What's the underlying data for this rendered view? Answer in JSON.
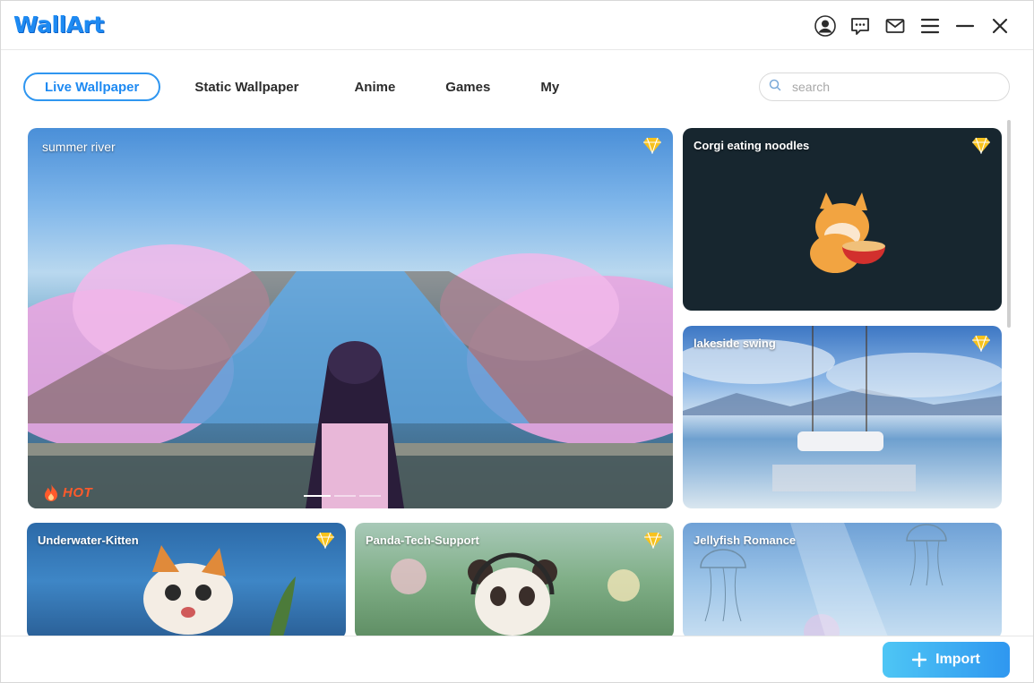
{
  "app": {
    "logo": "WallArt"
  },
  "titlebar": {
    "icons": [
      "user-icon",
      "feedback-icon",
      "mail-icon",
      "menu-icon",
      "minimize-icon",
      "close-icon"
    ]
  },
  "tabs": [
    {
      "label": "Live Wallpaper",
      "active": true
    },
    {
      "label": "Static Wallpaper",
      "active": false
    },
    {
      "label": "Anime",
      "active": false
    },
    {
      "label": "Games",
      "active": false
    },
    {
      "label": "My",
      "active": false
    }
  ],
  "search": {
    "placeholder": "search",
    "value": ""
  },
  "cards": {
    "featured": {
      "title": "summer river",
      "badge": "HOT",
      "premium": true
    },
    "corgi": {
      "title": "Corgi eating noodles",
      "premium": true
    },
    "lake": {
      "title": "lakeside swing",
      "premium": true
    },
    "kitten": {
      "title": "Underwater-Kitten",
      "premium": true
    },
    "panda": {
      "title": "Panda-Tech-Support",
      "premium": true
    },
    "jelly": {
      "title": "Jellyfish Romance",
      "premium": false
    }
  },
  "footer": {
    "import_label": "Import"
  },
  "colors": {
    "accent": "#1e8af2",
    "gem": "#f7c21c",
    "hot": "#ff5a2b"
  }
}
